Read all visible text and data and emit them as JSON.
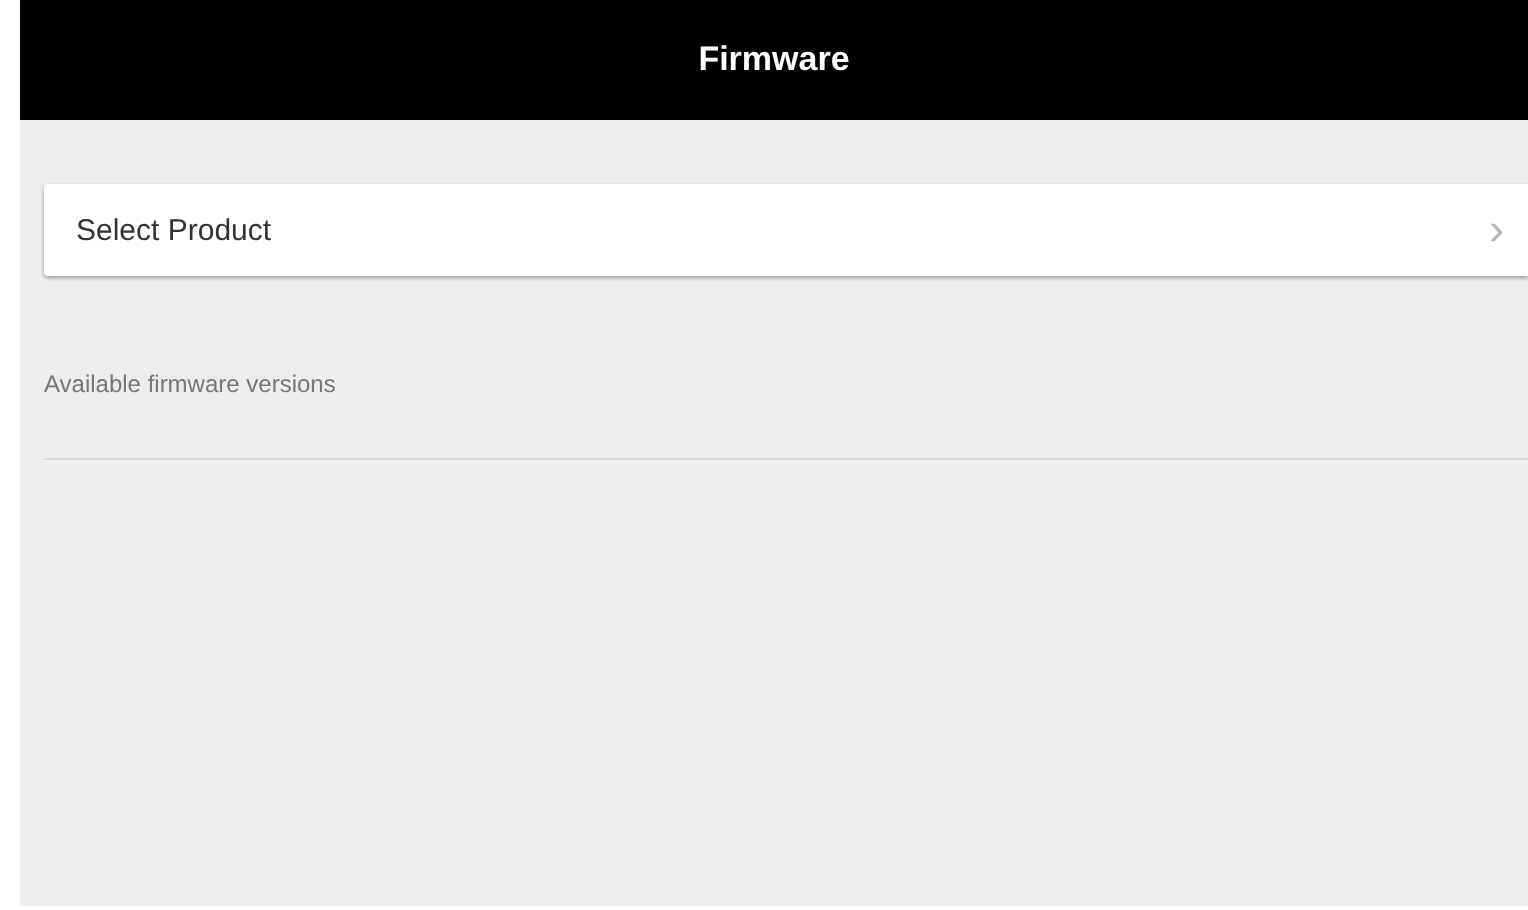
{
  "header": {
    "title": "Firmware"
  },
  "product_selector": {
    "label": "Select Product",
    "chevron": "›"
  },
  "versions_section": {
    "label": "Available firmware versions"
  }
}
